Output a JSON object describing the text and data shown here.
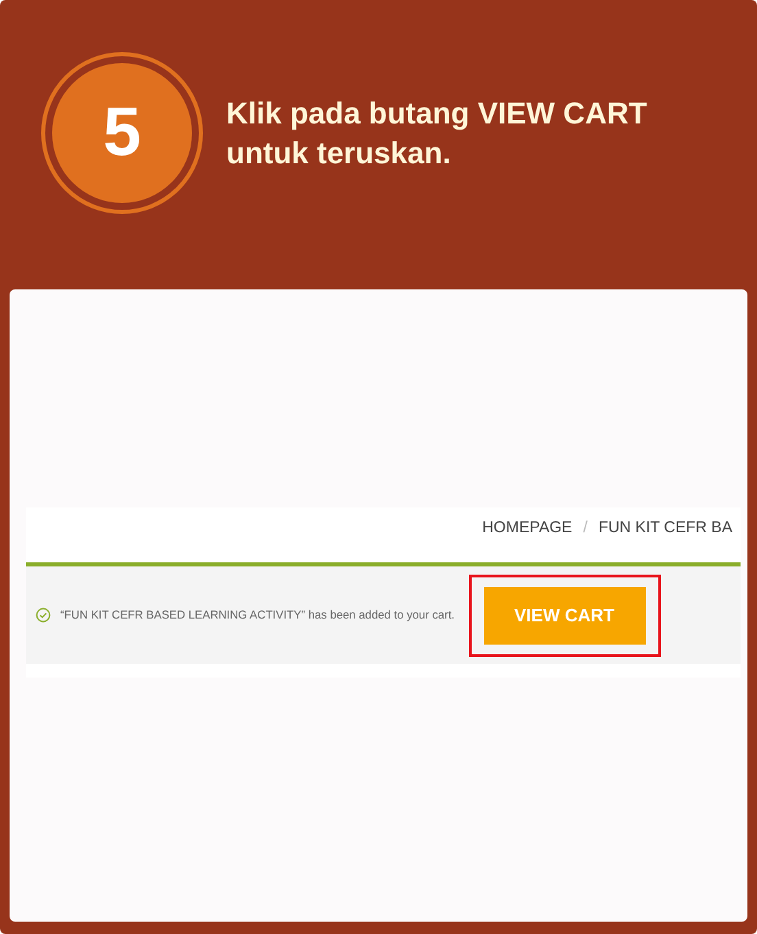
{
  "step": {
    "number": "5",
    "instruction": "Klik pada butang VIEW CART untuk teruskan."
  },
  "screenshot": {
    "breadcrumb": [
      "HOMEPAGE",
      "/",
      "FUN KIT CEFR BA"
    ],
    "notice": {
      "message": "“FUN KIT CEFR BASED LEARNING ACTIVITY” has been added to your cart.",
      "button": {
        "label": "VIEW CART",
        "highlighted": true
      }
    }
  }
}
